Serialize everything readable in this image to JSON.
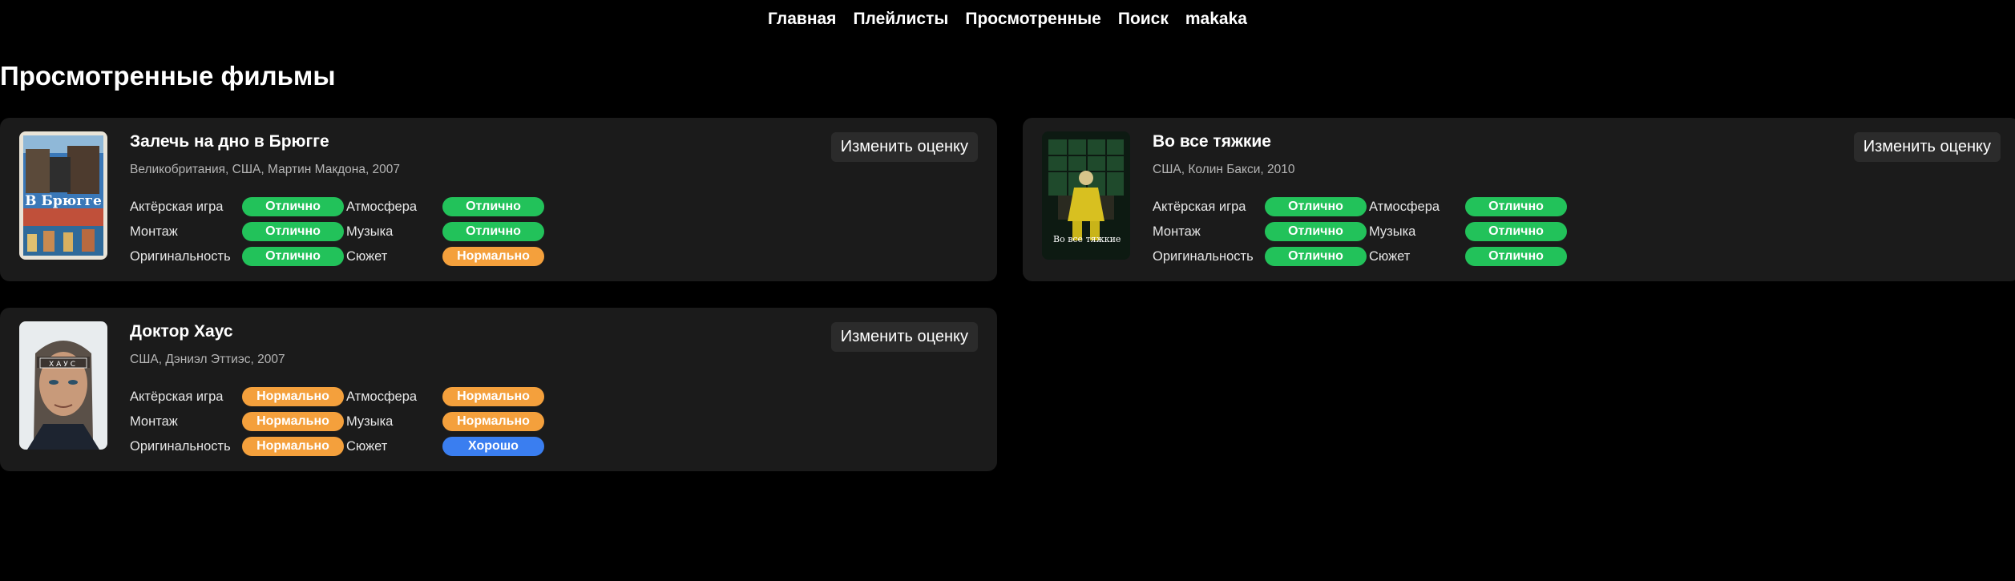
{
  "nav": {
    "items": [
      "Главная",
      "Плейлисты",
      "Просмотренные",
      "Поиск",
      "makaka"
    ]
  },
  "page": {
    "title": "Просмотренные фильмы"
  },
  "labels": {
    "acting": "Актёрская игра",
    "atmosphere": "Атмосфера",
    "editing": "Монтаж",
    "music": "Музыка",
    "originality": "Оригинальность",
    "plot": "Сюжет",
    "change_rating": "Изменить оценку"
  },
  "colors": {
    "excellent": "#22c25a",
    "normal": "#f4a03c",
    "good": "#3a7ef0"
  },
  "movies": [
    {
      "title": "Залечь на дно в Брюгге",
      "meta": "Великобритания, США, Мартин Макдона, 2007",
      "poster_text": "В Брюгге",
      "ratings": {
        "acting": "Отлично",
        "atmosphere": "Отлично",
        "editing": "Отлично",
        "music": "Отлично",
        "originality": "Отлично",
        "plot": "Нормально"
      }
    },
    {
      "title": "Во все тяжкие",
      "meta": "США, Колин Бакси, 2010",
      "poster_text": "Во все тяжкие",
      "ratings": {
        "acting": "Отлично",
        "atmosphere": "Отлично",
        "editing": "Отлично",
        "music": "Отлично",
        "originality": "Отлично",
        "plot": "Отлично"
      }
    },
    {
      "title": "Доктор Хаус",
      "meta": "США, Дэниэл Эттиэс, 2007",
      "poster_text": "ХАУС",
      "ratings": {
        "acting": "Нормально",
        "atmosphere": "Нормально",
        "editing": "Нормально",
        "music": "Нормально",
        "originality": "Нормально",
        "plot": "Хорошо"
      }
    }
  ]
}
